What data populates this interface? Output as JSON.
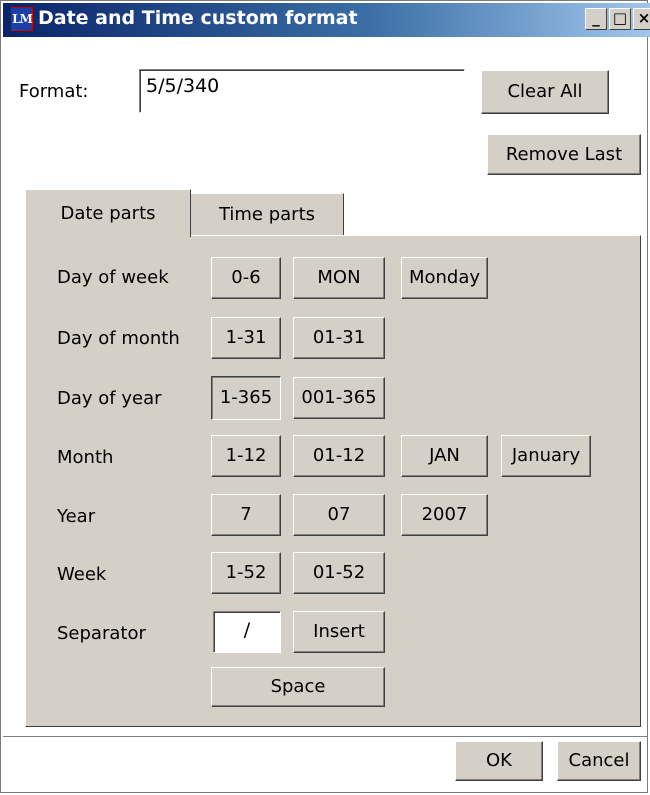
{
  "window": {
    "title": "Date and Time custom format",
    "icon_text": "LM"
  },
  "titlebar_buttons": {
    "minimize": "_",
    "maximize": "□",
    "close": "×"
  },
  "format": {
    "label": "Format:",
    "value": "5/5/340"
  },
  "buttons": {
    "clear_all": "Clear All",
    "remove_last": "Remove Last",
    "ok": "OK",
    "cancel": "Cancel"
  },
  "tabs": [
    {
      "label": "Date parts",
      "active": true
    },
    {
      "label": "Time parts",
      "active": false
    }
  ],
  "rows": [
    {
      "label": "Day of week",
      "buttons": [
        "0-6",
        "MON",
        "Monday"
      ]
    },
    {
      "label": "Day of month",
      "buttons": [
        "1-31",
        "01-31"
      ]
    },
    {
      "label": "Day of year",
      "buttons": [
        "1-365",
        "001-365"
      ],
      "pressed": "1-365"
    },
    {
      "label": "Month",
      "buttons": [
        "1-12",
        "01-12",
        "JAN",
        "January"
      ]
    },
    {
      "label": "Year",
      "buttons": [
        "7",
        "07",
        "2007"
      ]
    },
    {
      "label": "Week",
      "buttons": [
        "1-52",
        "01-52"
      ]
    },
    {
      "label": "Separator",
      "separator_value": "/",
      "insert_label": "Insert"
    }
  ],
  "space_button": "Space"
}
